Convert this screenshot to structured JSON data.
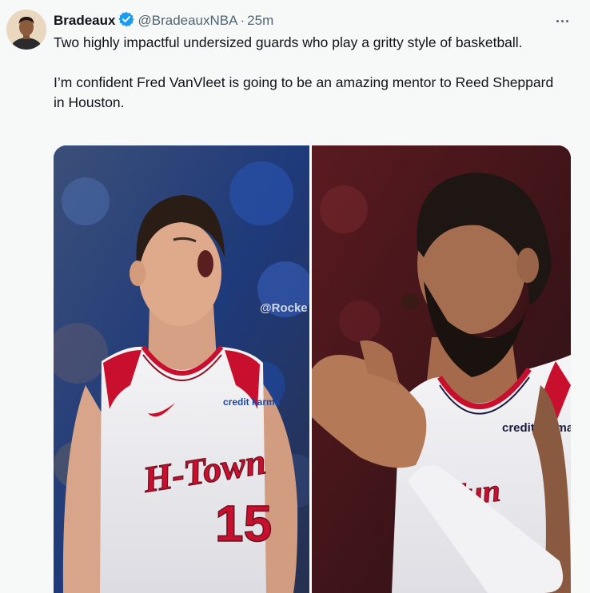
{
  "tweet": {
    "author": {
      "display_name": "Bradeaux",
      "handle": "@BradeauxNBA",
      "verified_icon": "verified-badge-icon",
      "verified_color": "#1d9bf0"
    },
    "separator": "·",
    "time": "25m",
    "more_icon": "more-horizontal-icon",
    "body": {
      "paragraph_1": "Two highly impactful undersized guards who play a gritty style of basketball.",
      "paragraph_2": "I’m confident Fred VanVleet is going to be an amazing mentor to Reed Sheppard in Houston."
    },
    "media": {
      "left_photo": {
        "jersey_wordmark": "H-Town",
        "jersey_number": "15",
        "jersey_sponsor": "credit karma",
        "watermark": "@Rocke"
      },
      "right_photo": {
        "jersey_sponsor": "credit karma"
      }
    }
  },
  "colors": {
    "background": "#f7f9f9",
    "text": "#0f1419",
    "secondary_text": "#536471",
    "jersey_red": "#c8102e"
  }
}
